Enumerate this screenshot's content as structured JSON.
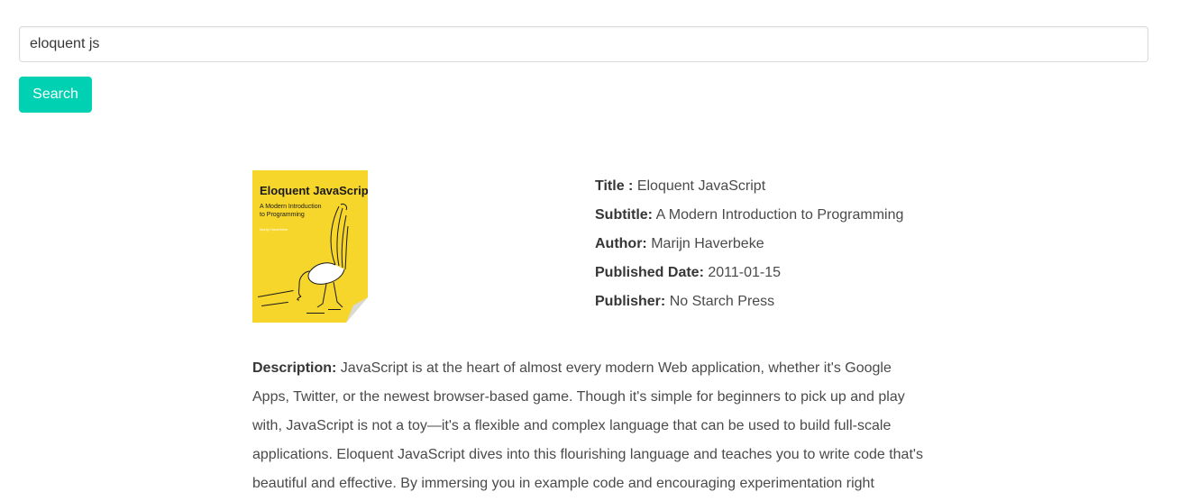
{
  "search": {
    "value": "eloquent js",
    "button_label": "Search"
  },
  "colors": {
    "primary": "#00d1b2",
    "cover_background": "#f7d62b"
  },
  "book": {
    "cover": {
      "title": "Eloquent JavaScript",
      "subtitle_line1": "A Modern Introduction",
      "subtitle_line2": "to Programming",
      "author": "Marijn Haverbeke"
    },
    "title_label": "Title",
    "title_sep": " : ",
    "title": "Eloquent JavaScript",
    "subtitle_label": "Subtitle:",
    "subtitle": "A Modern Introduction to Programming",
    "author_label": "Author:",
    "author": "Marijn Haverbeke",
    "published_date_label": "Published Date:",
    "published_date": "2011-01-15",
    "publisher_label": "Publisher:",
    "publisher": "No Starch Press",
    "description_label": "Description:",
    "description": "JavaScript is at the heart of almost every modern Web application, whether it's Google Apps, Twitter, or the newest browser-based game. Though it's simple for beginners to pick up and play with, JavaScript is not a toy—it's a flexible and complex language that can be used to build full-scale applications. Eloquent JavaScript dives into this flourishing language and teaches you to write code that's beautiful and effective. By immersing you in example code and encouraging experimentation right"
  }
}
